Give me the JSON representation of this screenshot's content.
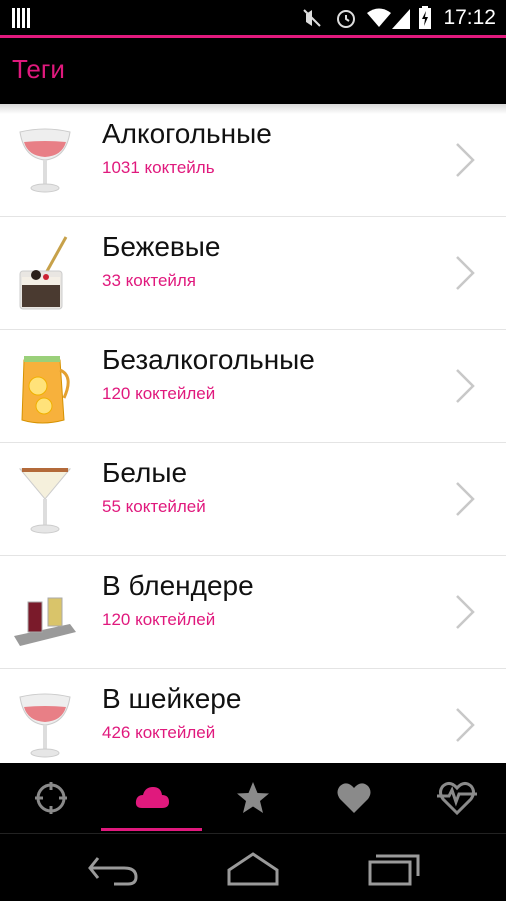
{
  "status": {
    "time": "17:12"
  },
  "header": {
    "title": "Теги"
  },
  "tags": [
    {
      "name": "Алкогольные",
      "count": "1031 коктейль",
      "image": "pink-coupe-glass"
    },
    {
      "name": "Бежевые",
      "count": "33 коктейля",
      "image": "dessert-glass-with-spoon"
    },
    {
      "name": "Безалкогольные",
      "count": "120 коктейлей",
      "image": "lemonade-pitcher"
    },
    {
      "name": "Белые",
      "count": "55 коктейлей",
      "image": "white-martini-glass"
    },
    {
      "name": "В блендере",
      "count": "120 коктейлей",
      "image": "smoothie-glasses-tray"
    },
    {
      "name": "В шейкере",
      "count": "426 коктейлей",
      "image": "pink-coupe-glass"
    }
  ],
  "tabs": [
    {
      "icon": "target-icon",
      "active": false
    },
    {
      "icon": "cloud-icon",
      "active": true
    },
    {
      "icon": "star-icon",
      "active": false
    },
    {
      "icon": "heart-icon",
      "active": false
    },
    {
      "icon": "heart-pulse-icon",
      "active": false
    }
  ],
  "navbar": [
    "back-icon",
    "home-icon",
    "recents-icon"
  ],
  "colors": {
    "accent": "#e0197d",
    "background": "#000000",
    "list_bg": "#ffffff"
  }
}
